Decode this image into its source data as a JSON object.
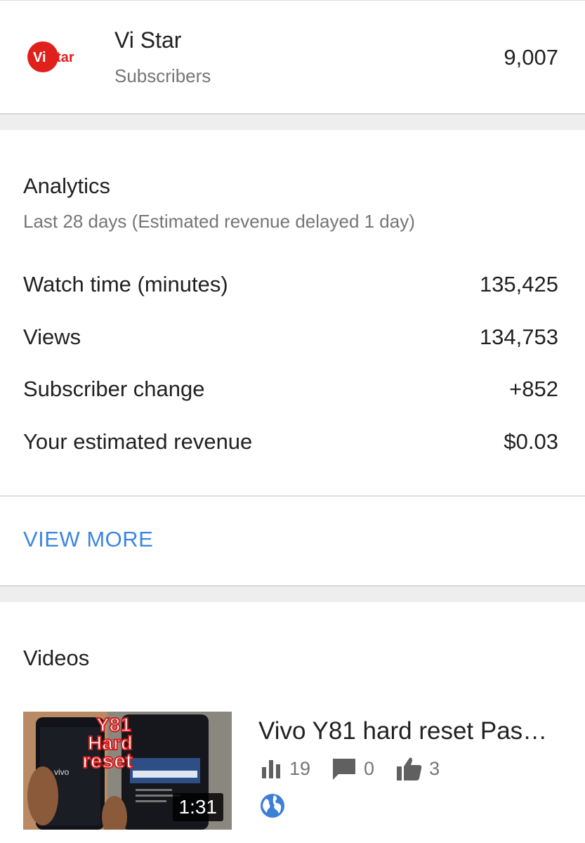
{
  "channel": {
    "logo_text": "ViStar",
    "name": "Vi Star",
    "subscribers_label": "Subscribers",
    "subscribers_count": "9,007"
  },
  "analytics": {
    "title": "Analytics",
    "subtitle": "Last 28 days (Estimated revenue delayed 1 day)",
    "metrics": [
      {
        "label": "Watch time (minutes)",
        "value": "135,425"
      },
      {
        "label": "Views",
        "value": "134,753"
      },
      {
        "label": "Subscriber change",
        "value": "+852"
      },
      {
        "label": "Your estimated revenue",
        "value": "$0.03"
      }
    ],
    "view_more_label": "VIEW MORE"
  },
  "videos": {
    "title": "Videos",
    "items": [
      {
        "title": "Vivo Y81 hard reset Pas…",
        "duration": "1:31",
        "thumbnail_text": [
          "Y81",
          "Hard",
          "reset"
        ],
        "views": "19",
        "comments": "0",
        "likes": "3",
        "visibility_icon": "globe-icon"
      }
    ]
  },
  "colors": {
    "accent_link": "#3d86e0",
    "logo_red": "#e0201b",
    "text_primary": "#212121",
    "text_secondary": "#757575",
    "icon_gray": "#606060",
    "globe_blue": "#3e7fd6"
  }
}
